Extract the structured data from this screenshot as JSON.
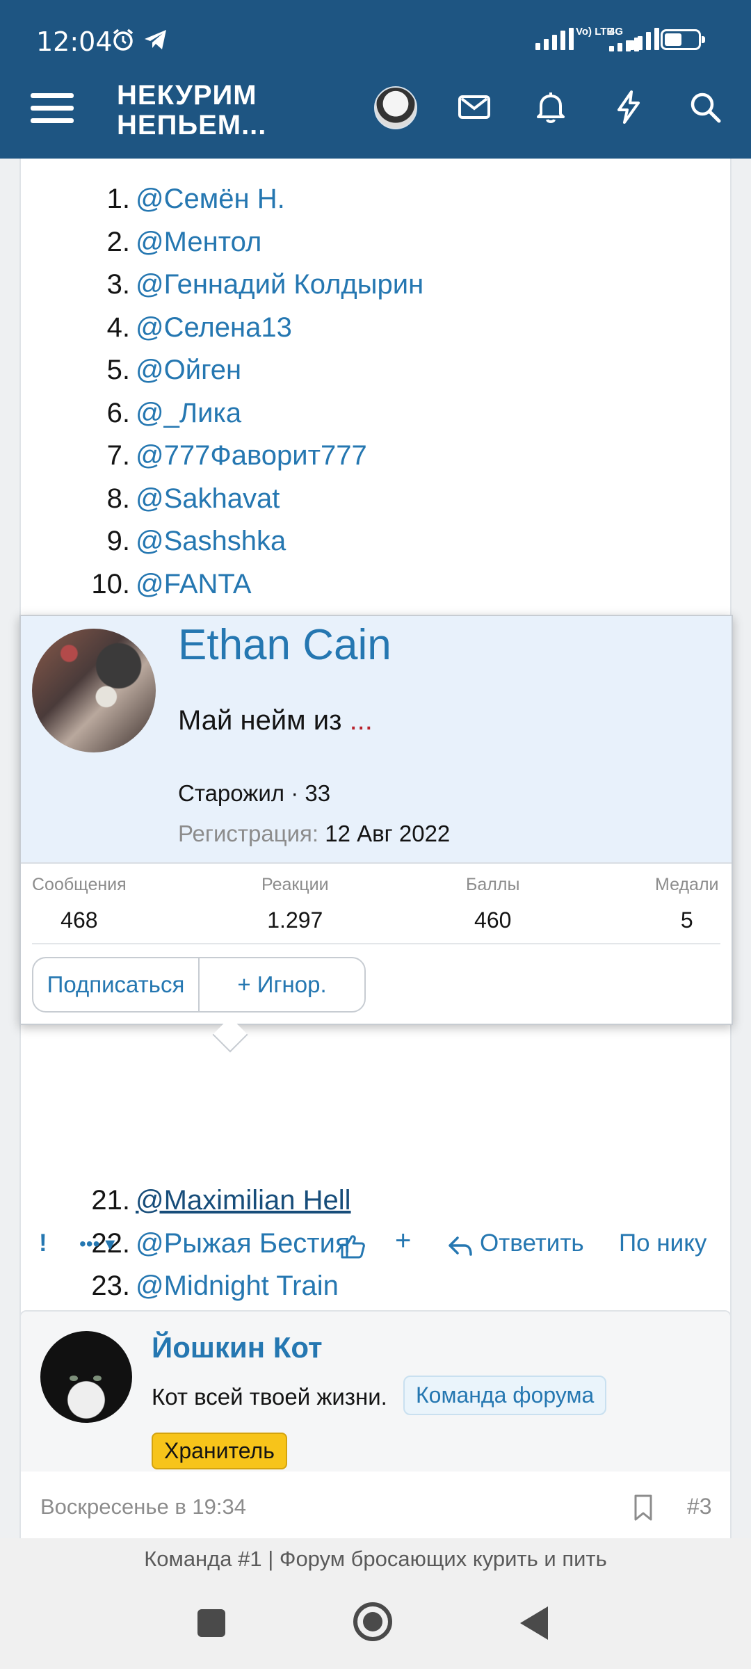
{
  "status_bar": {
    "time": "12:04",
    "volte": "Vo) LTE",
    "network": "4G"
  },
  "header": {
    "logo_line1": "НЕКУРИМ",
    "logo_line2": "НЕПЬЕМ...",
    "icons": [
      "menu-icon",
      "avatar",
      "mail-icon",
      "bell-icon",
      "bolt-icon",
      "search-icon"
    ],
    "accent_color": "#1e5582"
  },
  "mentions_top": [
    {
      "num": "1.",
      "name": "@Семён Н."
    },
    {
      "num": "2.",
      "name": "@Ментол"
    },
    {
      "num": "3.",
      "name": "@Геннадий Колдырин"
    },
    {
      "num": "4.",
      "name": "@Селена13"
    },
    {
      "num": "5.",
      "name": "@Ойген"
    },
    {
      "num": "6.",
      "name": "@_Лика"
    },
    {
      "num": "7.",
      "name": "@777Фаворит777"
    },
    {
      "num": "8.",
      "name": "@Sakhavat"
    },
    {
      "num": "9.",
      "name": "@Sashshka"
    },
    {
      "num": "10.",
      "name": "@FANTA"
    }
  ],
  "mentions_bottom": [
    {
      "num": "21.",
      "name": "@Maximilian Hell"
    },
    {
      "num": "22.",
      "name": "@Рыжая Бестия"
    },
    {
      "num": "23.",
      "name": "@Midnight Train"
    }
  ],
  "post_actions": {
    "report": "!",
    "more": "•••",
    "add": "+",
    "reply": "Ответить",
    "by_nick": "По нику"
  },
  "tooltip": {
    "name": "Ethan Cain",
    "status_text": "Май нейм из ",
    "status_ellipsis": "...",
    "rank": "Старожил · 33",
    "reg_label": "Регистрация:",
    "reg_value": "12 Авг 2022",
    "stats": [
      {
        "label": "Сообщения",
        "value": "468"
      },
      {
        "label": "Реакции",
        "value": "1.297"
      },
      {
        "label": "Баллы",
        "value": "460"
      },
      {
        "label": "Медали",
        "value": "5"
      }
    ],
    "follow_btn": "Подписаться",
    "ignore_btn": "+ Игнор."
  },
  "post2": {
    "username": "Йошкин Кот",
    "user_title": "Кот всей твоей жизни.",
    "badge": "Команда форума",
    "banner": "Хранитель",
    "date": "Воскресенье в 19:34",
    "post_num": "#3"
  },
  "footer": {
    "site_title": "Команда #1 | Форум бросающих курить и пить"
  },
  "colors": {
    "link": "#2577b1",
    "banner": "#f7c41a",
    "tooltip_bg": "#e8f1fb"
  }
}
